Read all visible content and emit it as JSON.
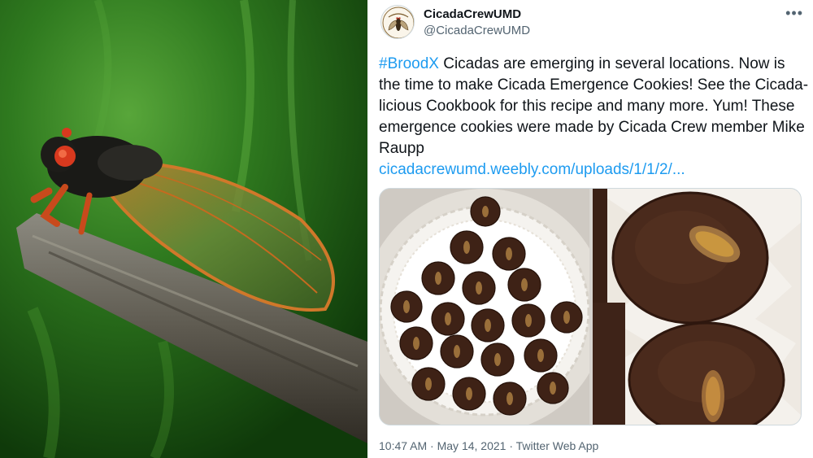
{
  "tweet": {
    "display_name": "CicadaCrewUMD",
    "handle": "@CicadaCrewUMD",
    "more_icon": "•••",
    "hashtag": "#BroodX",
    "text_body": " Cicadas are emerging in several locations. Now is the time to make Cicada Emergence Cookies! See the Cicada-licious Cookbook for this recipe and many more. Yum! These emergence cookies were made by Cicada Crew member Mike Raupp",
    "link": "cicadacrewumd.weebly.com/uploads/1/1/2/...",
    "time": "10:47 AM",
    "separator": " · ",
    "date": "May 14, 2021",
    "source": "Twitter Web App"
  },
  "icons": {
    "avatar": "cicada-crew-logo",
    "more": "more-options-icon"
  },
  "colors": {
    "link": "#1d9bf0",
    "text": "#0f1419",
    "secondary": "#536471"
  }
}
